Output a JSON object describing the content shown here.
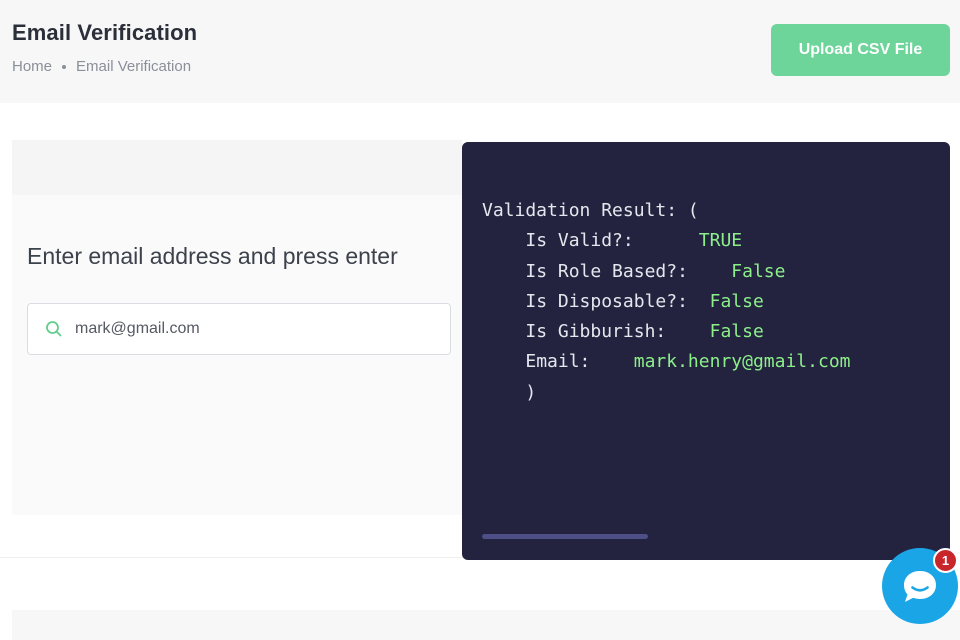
{
  "header": {
    "title": "Email Verification",
    "breadcrumb": {
      "home": "Home",
      "current": "Email Verification"
    },
    "upload_button_label": "Upload CSV File"
  },
  "form": {
    "prompt": "Enter email address and press enter",
    "input_value": "mark@gmail.com",
    "icon": "search-icon"
  },
  "result": {
    "header": "Validation Result: (",
    "rows": [
      {
        "key": "Is Valid?:",
        "gap": "      ",
        "value": "TRUE"
      },
      {
        "key": "Is Role Based?:",
        "gap": "    ",
        "value": "False"
      },
      {
        "key": "Is Disposable?:",
        "gap": "  ",
        "value": "False"
      },
      {
        "key": "Is Gibburish:",
        "gap": "    ",
        "value": "False"
      },
      {
        "key": "Email:",
        "gap": "    ",
        "value": "mark.henry@gmail.com"
      }
    ],
    "closing": ")"
  },
  "chat": {
    "icon": "chat-bubble-icon",
    "badge_count": "1"
  },
  "colors": {
    "accent_green": "#6dd49a",
    "result_bg": "#23233f",
    "value_green": "#8cf08a",
    "chat_blue": "#1aa6e6",
    "badge_red": "#c9262c"
  }
}
